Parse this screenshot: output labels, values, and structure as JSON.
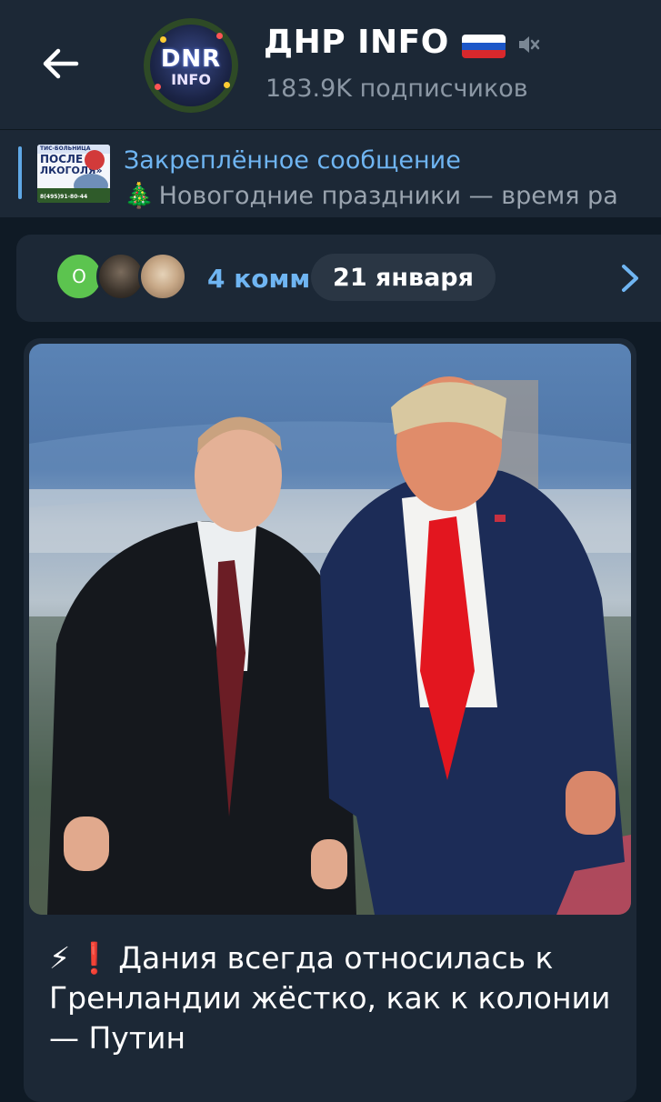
{
  "header": {
    "back_icon": "arrow-left-icon",
    "avatar_text_top": "DNR",
    "avatar_text_bottom": "INFO",
    "title": "ДНР INFO",
    "flag_icon": "russia-flag-icon",
    "mute_icon": "muted-speaker-icon",
    "subscribers": "183.9K подписчиков"
  },
  "pinned": {
    "label": "Закреплённое сообщение",
    "emoji": "🎄",
    "text": "Новогодние праздники — время ра",
    "thumb_line1": "ТИС-БОЛЬНИЦА",
    "thumb_line2": "ПОСЛЕ",
    "thumb_line3": "ЛКОГОЛЯ»",
    "thumb_line4": "8(495)91-80-44"
  },
  "comments": {
    "avatar_initial": "О",
    "text": "4 комм",
    "date_pill": "21 января",
    "chevron_icon": "chevron-right-icon"
  },
  "post": {
    "photo_icon": "post-photo",
    "text": "Дания всегда относилась к Гренландии жёстко, как к колонии — Путин",
    "emoji_1": "⚡",
    "emoji_2": "❗"
  },
  "colors": {
    "background": "#0f1a25",
    "panel": "#1c2836",
    "accent": "#6fb5f2",
    "muted_text": "#8b97a4"
  }
}
